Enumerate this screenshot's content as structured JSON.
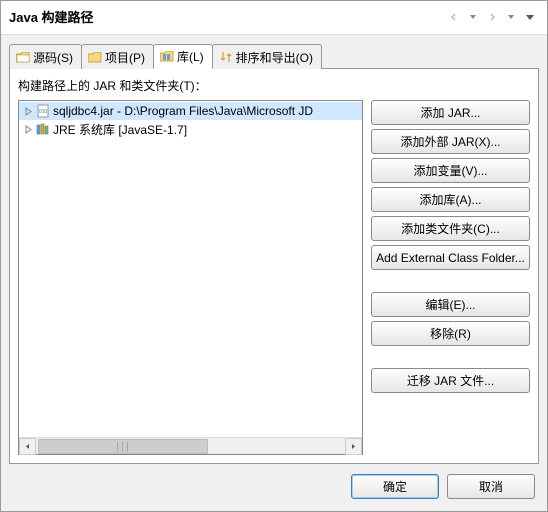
{
  "dialog": {
    "title": "Java 构建路径"
  },
  "tabs": [
    {
      "label": "源码(S)"
    },
    {
      "label": "项目(P)"
    },
    {
      "label": "库(L)"
    },
    {
      "label": "排序和导出(O)"
    }
  ],
  "panel": {
    "label": "构建路径上的 JAR 和类文件夹(T)："
  },
  "tree": [
    {
      "label": "sqljdbc4.jar - D:\\Program Files\\Java\\Microsoft JD",
      "icon": "jar",
      "selected": true
    },
    {
      "label": "JRE 系统库 [JavaSE-1.7]",
      "icon": "library",
      "selected": false
    }
  ],
  "buttons": {
    "addJar": "添加 JAR...",
    "addExternalJar": "添加外部 JAR(X)...",
    "addVariable": "添加变量(V)...",
    "addLibrary": "添加库(A)...",
    "addClassFolder": "添加类文件夹(C)...",
    "addExternalClassFolder": "Add External Class Folder...",
    "edit": "编辑(E)...",
    "remove": "移除(R)",
    "migrate": "迁移 JAR 文件..."
  },
  "footer": {
    "ok": "确定",
    "cancel": "取消"
  }
}
